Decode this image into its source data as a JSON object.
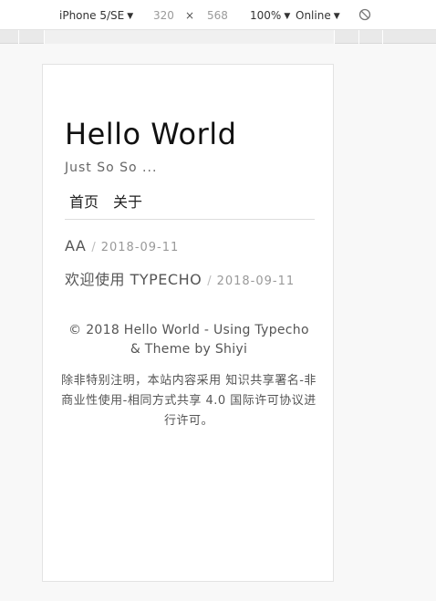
{
  "devtools": {
    "device": "iPhone 5/SE",
    "width": "320",
    "times": "×",
    "height": "568",
    "zoom": "100%",
    "network": "Online",
    "caret": "▼",
    "no_throttle_icon": "no-entry-circle"
  },
  "site": {
    "title": "Hello World",
    "description": "Just So So ..."
  },
  "nav": {
    "items": [
      {
        "label": "首页"
      },
      {
        "label": "关于"
      }
    ]
  },
  "posts": [
    {
      "title": "AA",
      "separator": "/",
      "date": "2018-09-11"
    },
    {
      "title": "欢迎使用 TYPECHO",
      "separator": "/",
      "date": "2018-09-11"
    }
  ],
  "footer": {
    "line1": "© 2018 Hello World - Using Typecho",
    "line2": "& Theme by Shiyi",
    "license": "除非特别注明，本站内容采用 知识共享署名-非商业性使用-相同方式共享 4.0 国际许可协议进行许可。"
  }
}
